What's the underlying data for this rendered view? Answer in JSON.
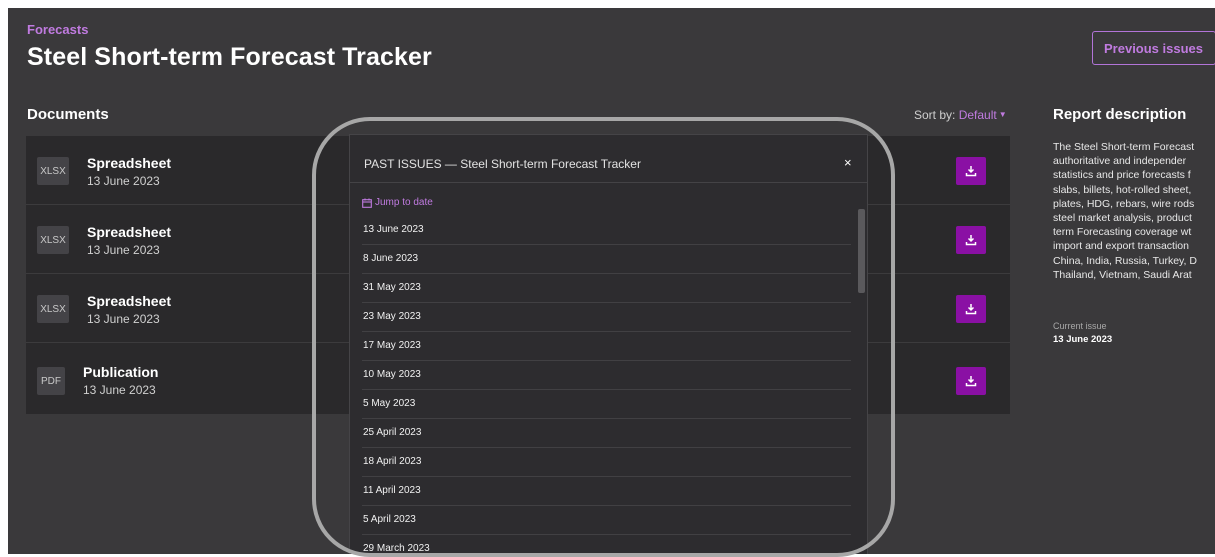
{
  "header": {
    "breadcrumb": "Forecasts",
    "title": "Steel Short-term Forecast Tracker",
    "previous_issues_label": "Previous issues"
  },
  "documents": {
    "heading": "Documents",
    "sort_label": "Sort by:",
    "sort_value": "Default",
    "items": [
      {
        "badge": "XLSX",
        "name": "Spreadsheet",
        "date": "13 June 2023"
      },
      {
        "badge": "XLSX",
        "name": "Spreadsheet",
        "date": "13 June 2023"
      },
      {
        "badge": "XLSX",
        "name": "Spreadsheet",
        "date": "13 June 2023"
      },
      {
        "badge": "PDF",
        "name": "Publication",
        "date": "13 June 2023"
      }
    ]
  },
  "report": {
    "heading": "Report description",
    "lines": [
      "The Steel Short-term Forecast",
      "authoritative and independer",
      "statistics and price forecasts f",
      "slabs, billets, hot-rolled sheet,",
      "plates, HDG, rebars, wire rods",
      "steel market analysis, product",
      "term Forecasting coverage wt",
      "import and export transaction",
      "China, India, Russia, Turkey, D",
      "Thailand, Vietnam, Saudi Arat"
    ],
    "current_issue_label": "Current issue",
    "current_issue_date": "13 June 2023"
  },
  "modal": {
    "title": "PAST ISSUES — Steel Short-term Forecast Tracker",
    "close_glyph": "×",
    "jump_label": "Jump to date",
    "issues": [
      "13 June 2023",
      "8 June 2023",
      "31 May 2023",
      "23 May 2023",
      "17 May 2023",
      "10 May 2023",
      "5 May 2023",
      "25 April 2023",
      "18 April 2023",
      "11 April 2023",
      "5 April 2023",
      "29 March 2023"
    ]
  },
  "colors": {
    "accent": "#c07be0",
    "download_button": "#8a10a4",
    "page_background": "#3a393b"
  },
  "icons": {
    "download": "download-icon",
    "calendar": "calendar-icon",
    "close": "close-icon",
    "sort_caret": "caret-down-icon"
  }
}
